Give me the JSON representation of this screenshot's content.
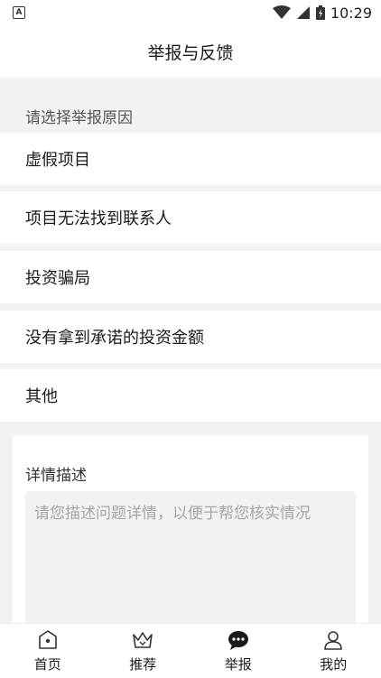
{
  "status_bar": {
    "time": "10:29",
    "notification_icon": "A"
  },
  "header": {
    "title": "举报与反馈"
  },
  "reasons": {
    "section_label": "请选择举报原因",
    "items": [
      {
        "label": "虚假项目"
      },
      {
        "label": "项目无法找到联系人"
      },
      {
        "label": "投资骗局"
      },
      {
        "label": "没有拿到承诺的投资金额"
      },
      {
        "label": "其他"
      }
    ]
  },
  "detail": {
    "title": "详情描述",
    "placeholder": "请您描述问题详情，以便于帮您核实情况"
  },
  "tabs": [
    {
      "label": "首页",
      "icon": "home-icon"
    },
    {
      "label": "推荐",
      "icon": "crown-icon"
    },
    {
      "label": "举报",
      "icon": "chat-icon"
    },
    {
      "label": "我的",
      "icon": "user-icon"
    }
  ]
}
